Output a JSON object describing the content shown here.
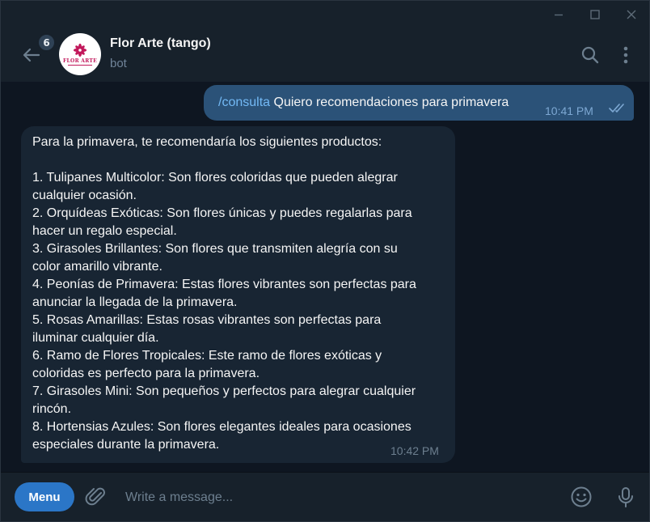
{
  "window": {
    "minimize_icon": "minimize-icon",
    "maximize_icon": "maximize-icon",
    "close_icon": "close-icon"
  },
  "header": {
    "unread_count": "6",
    "avatar_logo_text": "FLOR ARTE",
    "chat_name": "Flor Arte (tango)",
    "chat_status": "bot"
  },
  "messages": {
    "outgoing": {
      "command": "/consulta",
      "text": " Quiero recomendaciones para primavera",
      "time": "10:41 PM",
      "status": "read"
    },
    "incoming": {
      "lines": [
        "Para la primavera, te recomendaría los siguientes productos:",
        "",
        "1. Tulipanes Multicolor: Son flores coloridas que pueden alegrar",
        "cualquier ocasión.",
        "2. Orquídeas Exóticas: Son flores únicas y puedes regalarlas para",
        "hacer un regalo especial.",
        "3. Girasoles Brillantes: Son flores que transmiten alegría con su",
        "color amarillo vibrante.",
        "4. Peonías de Primavera: Estas flores vibrantes son perfectas para",
        "anunciar la llegada de la primavera.",
        "5. Rosas Amarillas: Estas rosas vibrantes son perfectas para",
        "iluminar cualquier día.",
        "6. Ramo de Flores Tropicales: Este ramo de flores exóticas y",
        "coloridas es perfecto para la primavera.",
        "7. Girasoles Mini: Son pequeños y perfectos para alegrar cualquier",
        "rincón.",
        "8. Hortensias Azules: Son flores elegantes ideales para ocasiones",
        "especiales durante la primavera."
      ],
      "time": "10:42 PM"
    }
  },
  "composer": {
    "menu_label": "Menu",
    "placeholder": "Write a message..."
  },
  "colors": {
    "background": "#0e1621",
    "panel": "#17212b",
    "outgoing_bubble": "#2b5278",
    "incoming_bubble": "#182533",
    "accent": "#2b76c7",
    "command_link": "#73b9f5"
  }
}
